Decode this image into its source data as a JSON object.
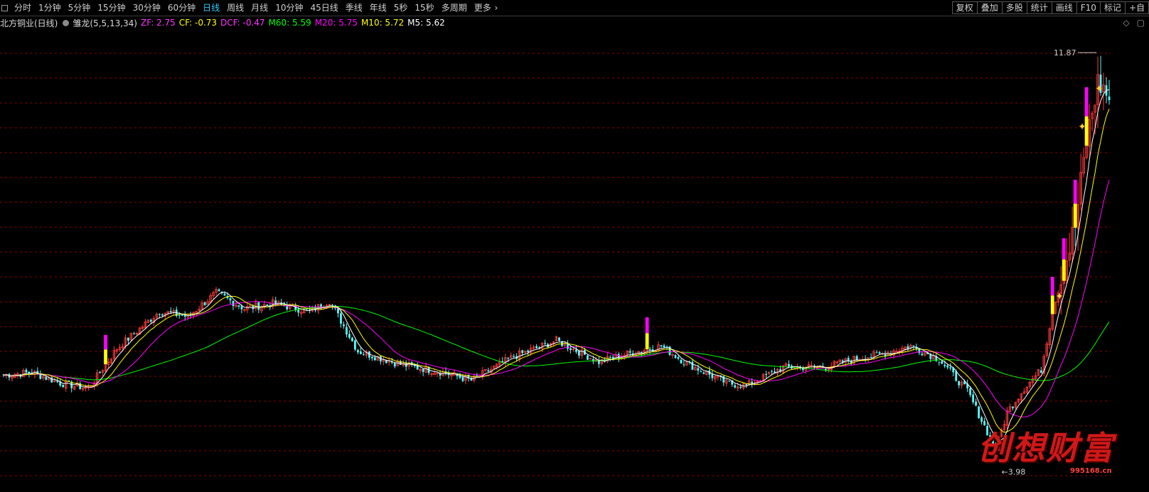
{
  "toolbar": {
    "periods": [
      "分时",
      "1分钟",
      "5分钟",
      "15分钟",
      "30分钟",
      "60分钟",
      "日线",
      "周线",
      "月线",
      "10分钟",
      "45日线",
      "季线",
      "年线",
      "5秒",
      "15秒",
      "多周期",
      "更多"
    ],
    "active_period": "日线",
    "tools": [
      "复权",
      "叠加",
      "多股",
      "统计",
      "画线",
      "F10",
      "标记",
      "+自"
    ]
  },
  "info": {
    "stock": "北方铜业(日线)",
    "indicator": "雏龙(5,5,13,34)",
    "zf_label": "ZF: 2.75",
    "cf_label": "CF: -0.73",
    "dcf_label": "DCF: -0.47",
    "m60_label": "M60: 5.59",
    "m20_label": "M20: 5.75",
    "m10_label": "M10: 5.72",
    "m5_label": "M5: 5.62"
  },
  "colors": {
    "background": "#000000",
    "up_candle": "#ff3c3c",
    "down_candle": "#54ffff",
    "gridline": "#8b0000",
    "m5": "#ffffff",
    "m10": "#ffff00",
    "m20": "#ff00ff",
    "m60": "#00ff00",
    "zf": "#ff33ff",
    "cf": "#ffff00",
    "dcf": "#ff33ff",
    "highlight_magenta": "#ff00ff",
    "highlight_yellow": "#ffff00"
  },
  "chart_data": {
    "type": "candlestick",
    "price_range": [
      3.6,
      12.3
    ],
    "grid": true,
    "high_label": "11.87",
    "low_label": "3.98",
    "anchors": [
      {
        "i": 0,
        "p": 5.8
      },
      {
        "i": 10,
        "p": 5.85
      },
      {
        "i": 20,
        "p": 5.65
      },
      {
        "i": 30,
        "p": 5.55
      },
      {
        "i": 40,
        "p": 6.3
      },
      {
        "i": 55,
        "p": 7.0
      },
      {
        "i": 65,
        "p": 6.9
      },
      {
        "i": 75,
        "p": 7.35
      },
      {
        "i": 85,
        "p": 7.05
      },
      {
        "i": 95,
        "p": 7.15
      },
      {
        "i": 108,
        "p": 7.0
      },
      {
        "i": 115,
        "p": 7.2
      },
      {
        "i": 125,
        "p": 6.25
      },
      {
        "i": 140,
        "p": 6.0
      },
      {
        "i": 155,
        "p": 5.85
      },
      {
        "i": 165,
        "p": 5.7
      },
      {
        "i": 180,
        "p": 6.15
      },
      {
        "i": 195,
        "p": 6.45
      },
      {
        "i": 210,
        "p": 6.05
      },
      {
        "i": 220,
        "p": 6.2
      },
      {
        "i": 232,
        "p": 6.35
      },
      {
        "i": 240,
        "p": 6.05
      },
      {
        "i": 255,
        "p": 5.65
      },
      {
        "i": 262,
        "p": 5.6
      },
      {
        "i": 275,
        "p": 5.95
      },
      {
        "i": 290,
        "p": 5.95
      },
      {
        "i": 300,
        "p": 6.1
      },
      {
        "i": 310,
        "p": 6.2
      },
      {
        "i": 320,
        "p": 6.35
      },
      {
        "i": 330,
        "p": 6.1
      },
      {
        "i": 340,
        "p": 5.5
      },
      {
        "i": 345,
        "p": 4.95
      },
      {
        "i": 350,
        "p": 4.4
      },
      {
        "i": 354,
        "p": 5.1
      },
      {
        "i": 360,
        "p": 5.55
      },
      {
        "i": 366,
        "p": 5.9
      },
      {
        "i": 370,
        "p": 7.0
      },
      {
        "i": 374,
        "p": 7.8
      },
      {
        "i": 378,
        "p": 8.6
      },
      {
        "i": 382,
        "p": 10.2
      },
      {
        "i": 386,
        "p": 11.3
      },
      {
        "i": 388,
        "p": 11.2
      },
      {
        "i": 390,
        "p": 11.0
      }
    ],
    "count": 391,
    "ma_periods": {
      "m5": 5,
      "m10": 10,
      "m20": 20,
      "m60": 60
    }
  },
  "watermark": {
    "text": "创想财富",
    "url": "995168.cn"
  }
}
